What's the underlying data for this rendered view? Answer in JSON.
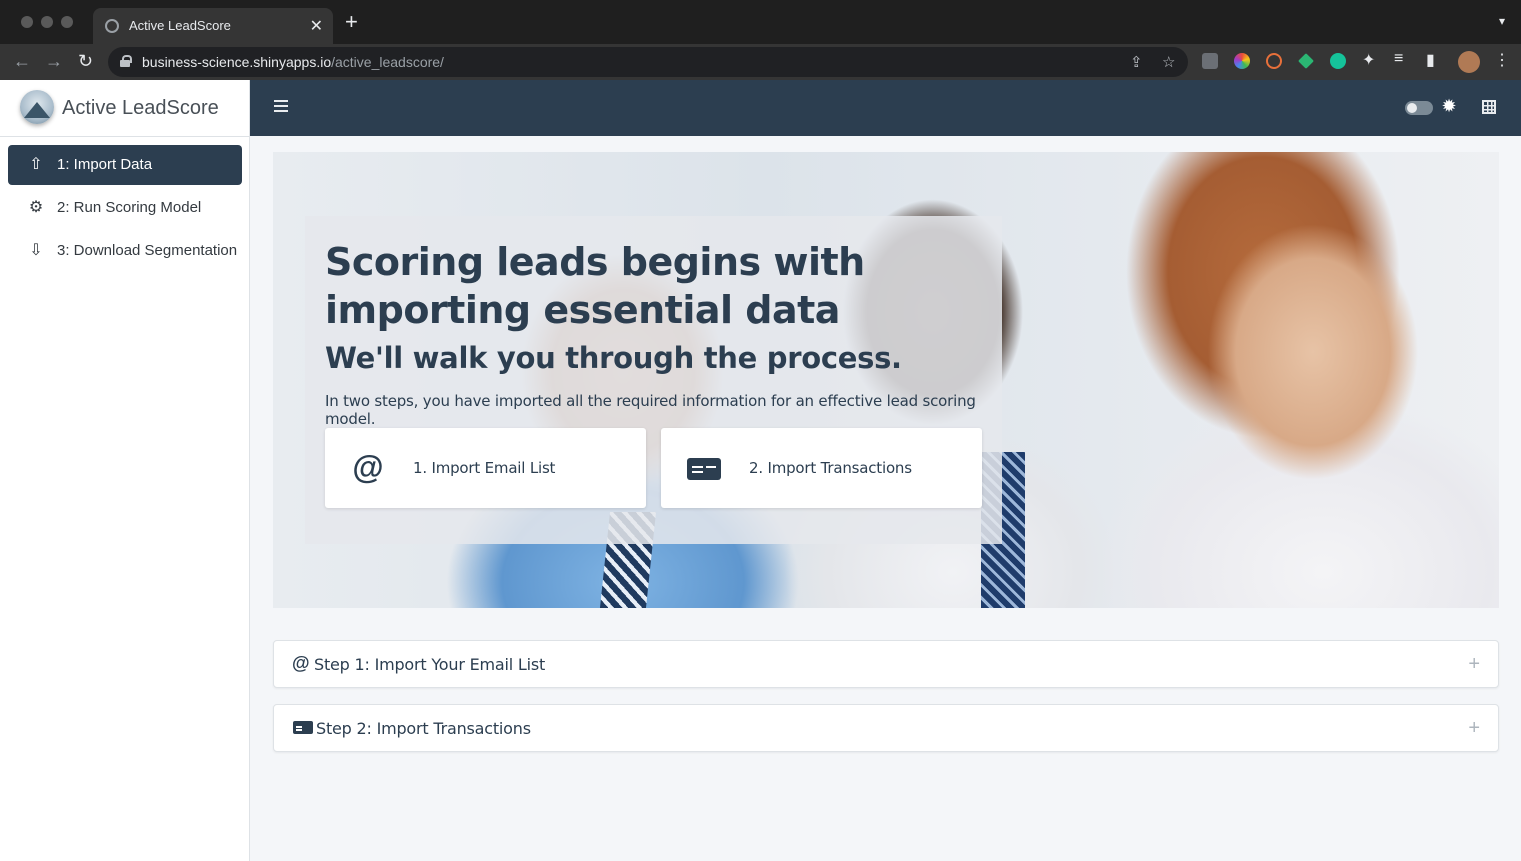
{
  "browser": {
    "tab_title": "Active LeadScore",
    "url_domain": "business-science.shinyapps.io",
    "url_path": "/active_leadscore/"
  },
  "sidebar": {
    "brand_title": "Active LeadScore",
    "items": [
      {
        "label": "1: Import Data",
        "icon": "upload-icon",
        "active": true
      },
      {
        "label": "2: Run Scoring Model",
        "icon": "gears-icon",
        "active": false
      },
      {
        "label": "3: Download Segmentation",
        "icon": "download-icon",
        "active": false
      }
    ]
  },
  "header": {
    "menu_icon": "hamburger-icon",
    "theme_toggle_icon": "toggle-icon",
    "theme_icon": "sun-icon",
    "grid_icon": "grid-icon"
  },
  "hero": {
    "title": "Scoring leads begins with importing essential data",
    "subtitle": "We'll walk you through the process.",
    "description": "In two steps, you have imported all the required information for an effective lead scoring model.",
    "cards": [
      {
        "label": "1. Import Email List",
        "icon": "at-icon"
      },
      {
        "label": "2. Import Transactions",
        "icon": "id-card-icon"
      }
    ]
  },
  "accordions": [
    {
      "title": "Step 1: Import Your Email List",
      "icon": "at-icon",
      "expanded": false
    },
    {
      "title": "Step 2: Import Transactions",
      "icon": "id-card-icon",
      "expanded": false
    }
  ],
  "colors": {
    "primary": "#2c3e50",
    "sidebar_bg": "#ffffff",
    "content_bg": "#f4f6f9"
  }
}
